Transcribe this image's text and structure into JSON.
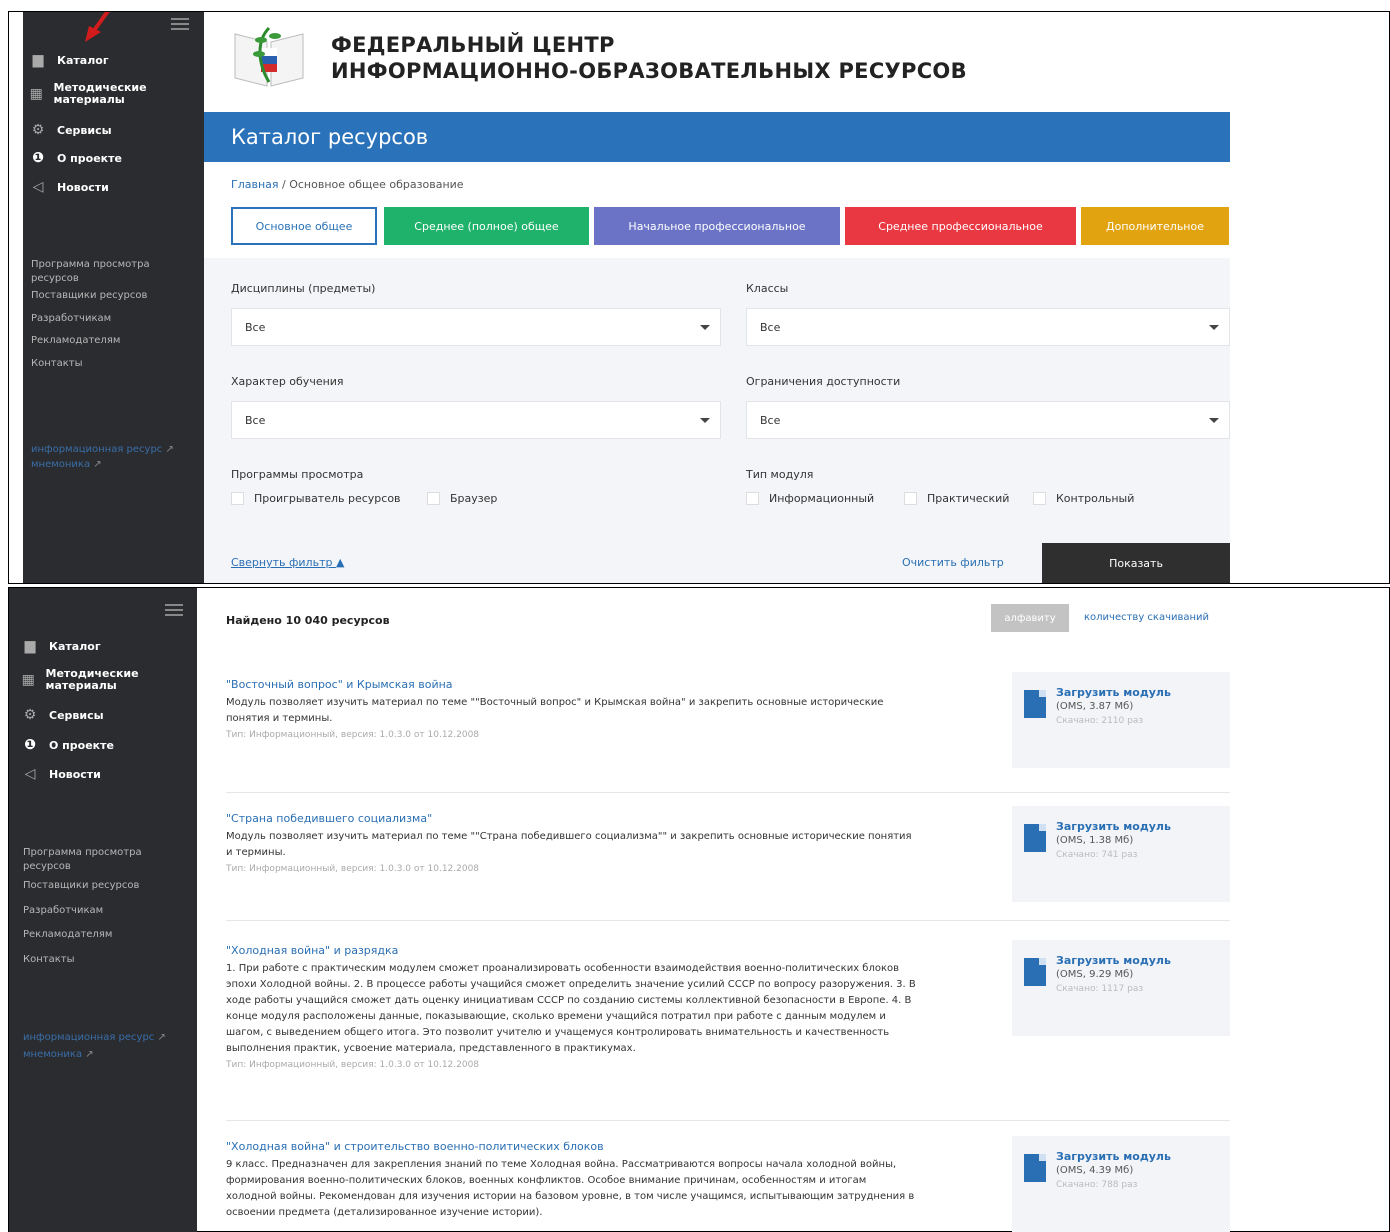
{
  "sidebar": {
    "items": [
      {
        "label": "Каталог",
        "icon": "catalog-icon"
      },
      {
        "label": "Методические материалы",
        "icon": "materials-icon"
      },
      {
        "label": "Сервисы",
        "icon": "gear-icon"
      },
      {
        "label": "О проекте",
        "icon": "info-icon"
      },
      {
        "label": "Новости",
        "icon": "megaphone-icon"
      }
    ],
    "links": [
      "Программа просмотра ресурсов",
      "Поставщики ресурсов",
      "Разработчикам",
      "Рекламодателям",
      "Контакты"
    ],
    "external": [
      "информационная ресурс",
      "мнемоника"
    ]
  },
  "header": {
    "title_line1": "ФЕДЕРАЛЬНЫЙ ЦЕНТР",
    "title_line2": "ИНФОРМАЦИОННО-ОБРАЗОВАТЕЛЬНЫХ РЕСУРСОВ"
  },
  "catalog": {
    "title": "Каталог ресурсов",
    "breadcrumb_home": "Главная",
    "breadcrumb_current": " / Основное общее образование",
    "tabs": [
      {
        "label": "Основное общее",
        "color": "#ffffff"
      },
      {
        "label": "Среднее (полное) общее",
        "color": "#1fb26b"
      },
      {
        "label": "Начальное профессиональное",
        "color": "#6a73c5"
      },
      {
        "label": "Среднее профессиональное",
        "color": "#ea3842"
      },
      {
        "label": "Дополнительное",
        "color": "#e2a311"
      }
    ]
  },
  "filters": {
    "disciplines_label": "Дисциплины (предметы)",
    "disciplines_value": "Все",
    "classes_label": "Классы",
    "classes_value": "Все",
    "character_label": "Характер обучения",
    "character_value": "Все",
    "access_label": "Ограничения доступности",
    "access_value": "Все",
    "programs_label": "Программы просмотра",
    "programs": [
      "Проигрыватель ресурсов",
      "Браузер"
    ],
    "module_type_label": "Тип модуля",
    "module_types": [
      "Информационный",
      "Практический",
      "Контрольный"
    ],
    "collapse": "Свернуть фильтр",
    "clear": "Очистить фильтр",
    "show": "Показать"
  },
  "results": {
    "found": "Найдено 10 040 ресурсов",
    "sort_alpha": "алфавиту",
    "sort_downloads": "количеству скачиваний",
    "download_label": "Загрузить модуль",
    "items": [
      {
        "title": "\"Восточный вопрос\" и Крымская война",
        "desc": "Модуль позволяет изучить материал по теме \"\"Восточный вопрос\" и Крымская война\" и закрепить основные исторические понятия и термины.",
        "meta": "Тип: Информационный, версия: 1.0.3.0 от 10.12.2008",
        "size": "(OMS, 3.87 Мб)",
        "count": "Скачано: 2110 раз"
      },
      {
        "title": "\"Страна победившего социализма\"",
        "desc": "Модуль позволяет изучить материал по теме \"\"Страна победившего социализма\"\" и закрепить основные исторические понятия и термины.",
        "meta": "Тип: Информационный, версия: 1.0.3.0 от 10.12.2008",
        "size": "(OMS, 1.38 Мб)",
        "count": "Скачано: 741 раз"
      },
      {
        "title": "\"Холодная война\" и разрядка",
        "desc": "1. При работе с практическим модулем сможет проанализировать особенности взаимодействия военно-политических блоков эпохи Холодной войны. 2. В процессе работы учащийся сможет определить значение усилий СССР по вопросу разоружения. 3. В ходе работы учащийся сможет дать оценку инициативам СССР по созданию системы коллективной безопасности в Европе. 4. В конце модуля расположены данные, показывающие, сколько времени учащийся потратил при работе с данным модулем и шагом, с выведением общего итога. Это позволит учителю и учащемуся контролировать внимательность и качественность выполнения практик, усвоение материала, представленного в практикумах.",
        "meta": "Тип: Информационный, версия: 1.0.3.0 от 10.12.2008",
        "size": "(OMS, 9.29 Мб)",
        "count": "Скачано: 1117 раз"
      },
      {
        "title": "\"Холодная война\" и строительство военно-политических блоков",
        "desc": "9 класс. Предназначен для закрепления знаний по теме Холодная война. Рассматриваются вопросы начала холодной войны, формирования военно-политических блоков, военных конфликтов. Особое внимание причинам, особенностям и итогам холодной войны. Рекомендован для изучения истории на базовом уровне, в том числе учащимся, испытывающим затруднения в освоении предмета (детализированное изучение истории).",
        "meta": "",
        "size": "(OMS, 4.39 Мб)",
        "count": "Скачано: 788 раз"
      }
    ]
  }
}
